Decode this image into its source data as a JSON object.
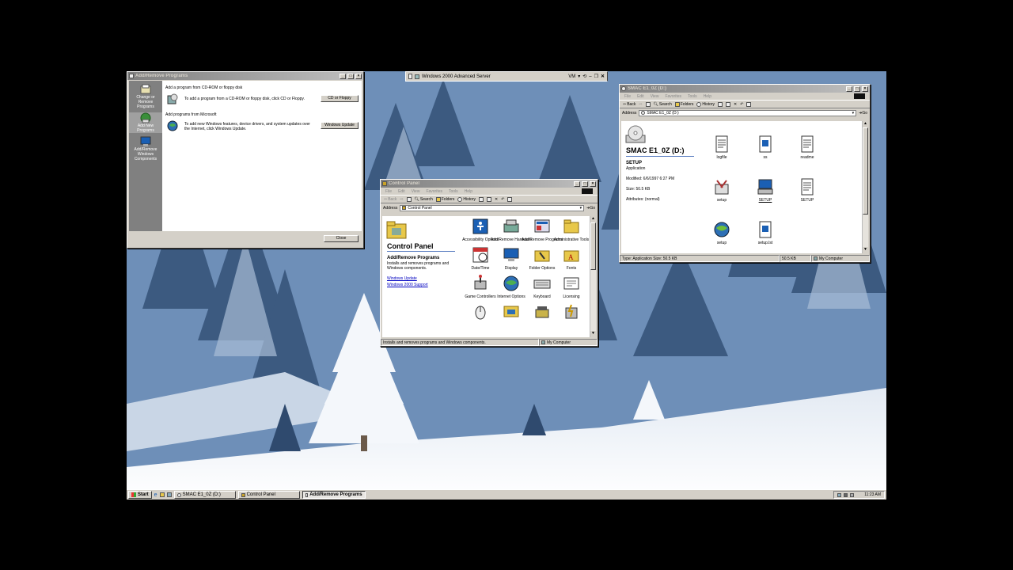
{
  "vm_window": {
    "title": "Windows 2000 Advanced Server",
    "menu": "VM"
  },
  "add_remove": {
    "title": "Add/Remove Programs",
    "sidebar": [
      {
        "label": "Change or Remove Programs",
        "icon": "change-remove-programs-icon"
      },
      {
        "label": "Add New Programs",
        "icon": "add-new-programs-icon"
      },
      {
        "label": "Add/Remove Windows Components",
        "icon": "windows-components-icon"
      }
    ],
    "cd_heading": "Add a program from CD-ROM or floppy disk",
    "cd_text": "To add a program from a CD-ROM or floppy disk, click CD or Floppy.",
    "cd_button": "CD or Floppy",
    "ms_heading": "Add programs from Microsoft",
    "ms_text": "To add new Windows features, device drivers, and system updates over the Internet, click Windows Update.",
    "ms_button": "Windows Update",
    "close": "Close"
  },
  "control_panel": {
    "title": "Control Panel",
    "menu": [
      "File",
      "Edit",
      "View",
      "Favorites",
      "Tools",
      "Help"
    ],
    "toolbar": {
      "back": "Back",
      "search": "Search",
      "folders": "Folders",
      "history": "History"
    },
    "address_label": "Address",
    "address": "Control Panel",
    "go": "Go",
    "heading": "Control Panel",
    "selected_title": "Add/Remove Programs",
    "selected_desc": "Installs and removes programs and Windows components.",
    "links": [
      "Windows Update",
      "Windows 2000 Support"
    ],
    "items": [
      {
        "label": "Accessibility Options",
        "icon": "accessibility-icon"
      },
      {
        "label": "Add/Remove Hardware",
        "icon": "add-hardware-icon"
      },
      {
        "label": "Add/Remove Programs",
        "icon": "add-remove-programs-icon"
      },
      {
        "label": "Administrative Tools",
        "icon": "admin-tools-icon"
      },
      {
        "label": "Fonts",
        "icon": "fonts-icon"
      },
      {
        "label": "Date/Time",
        "icon": "datetime-icon"
      },
      {
        "label": "Display",
        "icon": "display-icon"
      },
      {
        "label": "Folder Options",
        "icon": "folder-options-icon"
      },
      {
        "label": "Fonts",
        "icon": "fonts-icon"
      },
      {
        "label": "Game Controllers",
        "icon": "game-controllers-icon"
      },
      {
        "label": "Internet Options",
        "icon": "internet-options-icon"
      },
      {
        "label": "Keyboard",
        "icon": "keyboard-icon"
      },
      {
        "label": "Licensing",
        "icon": "licensing-icon"
      },
      {
        "label": "",
        "icon": "mouse-icon"
      },
      {
        "label": "",
        "icon": "network-icon"
      },
      {
        "label": "",
        "icon": "phone-modem-icon"
      },
      {
        "label": "",
        "icon": "power-options-icon"
      }
    ],
    "status": "Installs and removes programs and Windows components.",
    "status_zone": "My Computer"
  },
  "smac": {
    "title": "SMAC E1_0Z (D:)",
    "menu": [
      "File",
      "Edit",
      "View",
      "Favorites",
      "Tools",
      "Help"
    ],
    "toolbar": {
      "back": "Back",
      "search": "Search",
      "folders": "Folders",
      "history": "History"
    },
    "address_label": "Address",
    "address": "SMAC E1_0Z (D:)",
    "go": "Go",
    "drive_name": "SMAC E1_0Z (D:)",
    "selected_name": "SETUP",
    "selected_type": "Application",
    "modified": "Modified: 6/6/1997 6:27 PM",
    "size": "Size: 50.5 KB",
    "attributes": "Attributes: (normal)",
    "files": [
      {
        "label": "logfile",
        "icon": "text-file-icon"
      },
      {
        "label": "ss",
        "icon": "app-file-icon"
      },
      {
        "label": "readme",
        "icon": "text-file-icon"
      },
      {
        "label": "setup",
        "icon": "setup-tools-icon"
      },
      {
        "label": "SETUP",
        "icon": "setup-computer-icon"
      },
      {
        "label": "SETUP",
        "icon": "text-file-icon"
      },
      {
        "label": "setup",
        "icon": "globe-setup-icon"
      },
      {
        "label": "setup.lst",
        "icon": "app-file-icon"
      }
    ],
    "status_type": "Type: Application Size: 50.5 KB",
    "status_size": "50.5 KB",
    "status_zone": "My Computer"
  },
  "taskbar": {
    "start": "Start",
    "tasks": [
      "SMAC E1_0Z (D:)",
      "Control Panel",
      "Add/Remove Programs"
    ],
    "clock": "11:23 AM"
  }
}
